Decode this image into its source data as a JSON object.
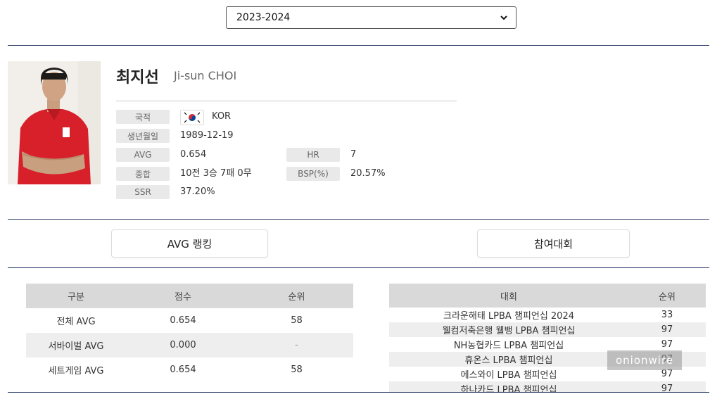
{
  "season": {
    "selected": "2023-2024"
  },
  "player": {
    "name_ko": "최지선",
    "name_en": "Ji-sun CHOI",
    "fields": {
      "nationality_label": "국적",
      "nationality": "KOR",
      "birth_label": "생년월일",
      "birth": "1989-12-19",
      "avg_label": "AVG",
      "avg": "0.654",
      "hr_label": "HR",
      "hr": "7",
      "total_label": "종합",
      "total": "10전 3승 7패 0무",
      "bsp_label": "BSP(%)",
      "bsp": "20.57%",
      "ssr_label": "SSR",
      "ssr": "37.20%"
    }
  },
  "tabs": {
    "avg_ranking": "AVG 랭킹",
    "tournaments": "참여대회"
  },
  "avg_table": {
    "headers": [
      "구분",
      "점수",
      "순위"
    ],
    "rows": [
      [
        "전체 AVG",
        "0.654",
        "58"
      ],
      [
        "서바이벌 AVG",
        "0.000",
        "-"
      ],
      [
        "세트게임 AVG",
        "0.654",
        "58"
      ]
    ]
  },
  "tour_table": {
    "headers": [
      "대회",
      "순위"
    ],
    "rows": [
      [
        "크라운해태 LPBA 챔피언십 2024",
        "33"
      ],
      [
        "웰컴저축은행 웰뱅 LPBA 챔피언십",
        "97"
      ],
      [
        "NH농협카드 LPBA 챔피언십",
        "97"
      ],
      [
        "휴온스 LPBA 챔피언십",
        "97"
      ],
      [
        "에스와이 LPBA 챔피언십",
        "97"
      ],
      [
        "하나카드 LPBA 챔피언십",
        "97"
      ]
    ]
  },
  "watermark": "onionwire",
  "colors": {
    "rule": "#2b3a67",
    "chip": "#e9e9e9",
    "table_header": "#d9d9d9"
  }
}
